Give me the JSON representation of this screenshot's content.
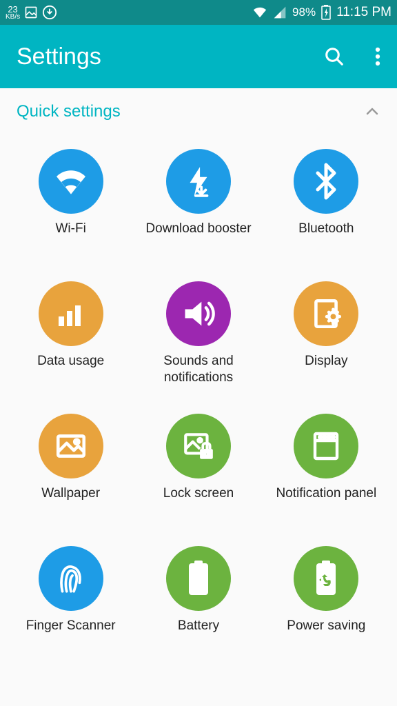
{
  "status": {
    "speed_value": "23",
    "speed_unit": "KB/s",
    "battery": "98%",
    "time": "11:15 PM"
  },
  "header": {
    "title": "Settings"
  },
  "section": {
    "title": "Quick settings"
  },
  "items": [
    {
      "label": "Wi-Fi"
    },
    {
      "label": "Download booster"
    },
    {
      "label": "Bluetooth"
    },
    {
      "label": "Data usage"
    },
    {
      "label": "Sounds and notifications"
    },
    {
      "label": "Display"
    },
    {
      "label": "Wallpaper"
    },
    {
      "label": "Lock screen"
    },
    {
      "label": "Notification panel"
    },
    {
      "label": "Finger Scanner"
    },
    {
      "label": "Battery"
    },
    {
      "label": "Power saving"
    }
  ]
}
